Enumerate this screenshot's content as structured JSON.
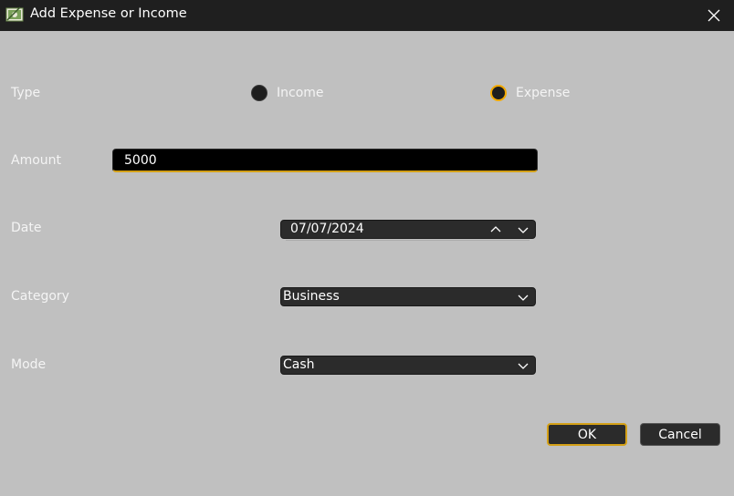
{
  "window": {
    "title": "Add Expense or Income"
  },
  "form": {
    "type": {
      "label": "Type",
      "options": [
        "Income",
        "Expense"
      ],
      "selected": "Expense"
    },
    "amount": {
      "label": "Amount",
      "value": "5000"
    },
    "date": {
      "label": "Date",
      "value": "07/07/2024"
    },
    "category": {
      "label": "Category",
      "value": "Business"
    },
    "mode": {
      "label": "Mode",
      "value": "Cash"
    }
  },
  "buttons": {
    "ok": "OK",
    "cancel": "Cancel"
  },
  "colors": {
    "accent": "#f2a900",
    "background": "#c0c0c0",
    "titlebar": "#1f1f1f",
    "control": "#2b2b2b"
  }
}
